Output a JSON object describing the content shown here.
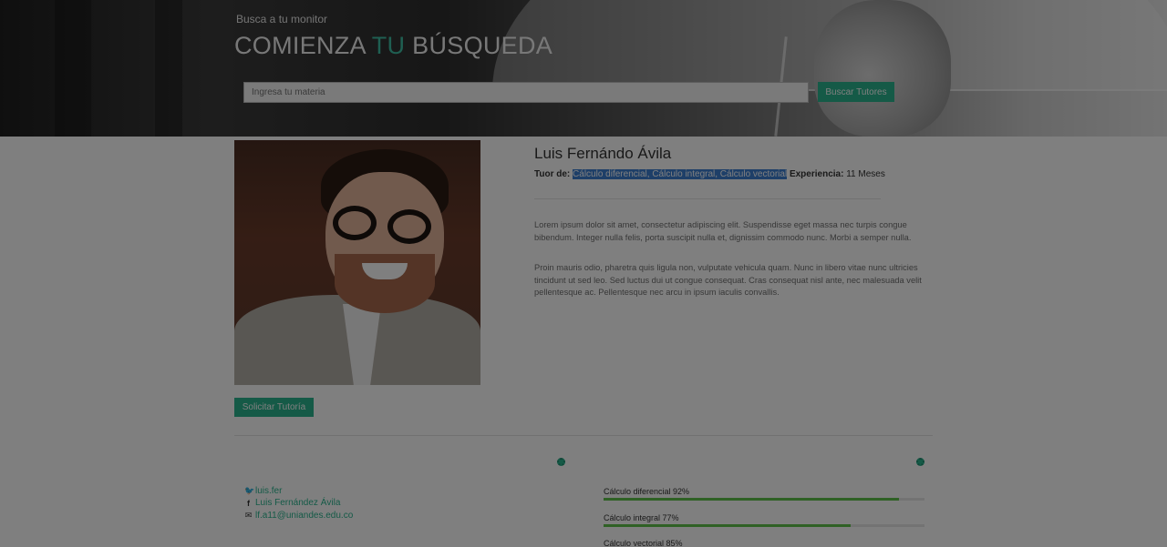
{
  "hero": {
    "subtitle": "Busca a tu monitor",
    "title_part1": "COMIENZA",
    "title_accent": "TU",
    "title_part2": "BÚSQUEDA",
    "search_placeholder": "Ingresa tu materia",
    "search_button": "Buscar Tutores"
  },
  "profile": {
    "name": "Luis Fernándo Ávila",
    "tutor_label": "Tuor de:",
    "subjects": "Cálculo diferencial, Cálculo integral, Cálculo vectorial",
    "experience_label": "Experiencia:",
    "experience_value": "11 Meses",
    "paragraph_1": "Lorem ipsum dolor sit amet, consectetur adipiscing elit. Suspendisse eget massa nec turpis congue bibendum. Integer nulla felis, porta suscipit nulla et, dignissim commodo nunc. Morbi a semper nulla.",
    "paragraph_2": "Proin mauris odio, pharetra quis ligula non, vulputate vehicula quam. Nunc in libero vitae nunc ultricies tincidunt ut sed leo. Sed luctus dui ut congue consequat. Cras consequat nisl ante, nec malesuada velit pellentesque ac. Pellentesque nec arcu in ipsum iaculis convallis.",
    "request_button": "Solicitar Tutoría"
  },
  "contacts": [
    {
      "icon": "twitter-icon",
      "text": "luis.fer"
    },
    {
      "icon": "facebook-icon",
      "text": "Luis Fernández Ávila"
    },
    {
      "icon": "envelope-icon",
      "text": "lf.a11@uniandes.edu.co"
    }
  ],
  "skills": [
    {
      "label": "Cálculo diferencial 92%",
      "percent": 92
    },
    {
      "label": "Cálculo integral 77%",
      "percent": 77
    },
    {
      "label": "Cálculo vectorial 85%",
      "percent": 85
    }
  ],
  "colors": {
    "accent": "#2ab58f",
    "skill_bar": "#5ec24a",
    "selection": "#3d7fd1"
  }
}
